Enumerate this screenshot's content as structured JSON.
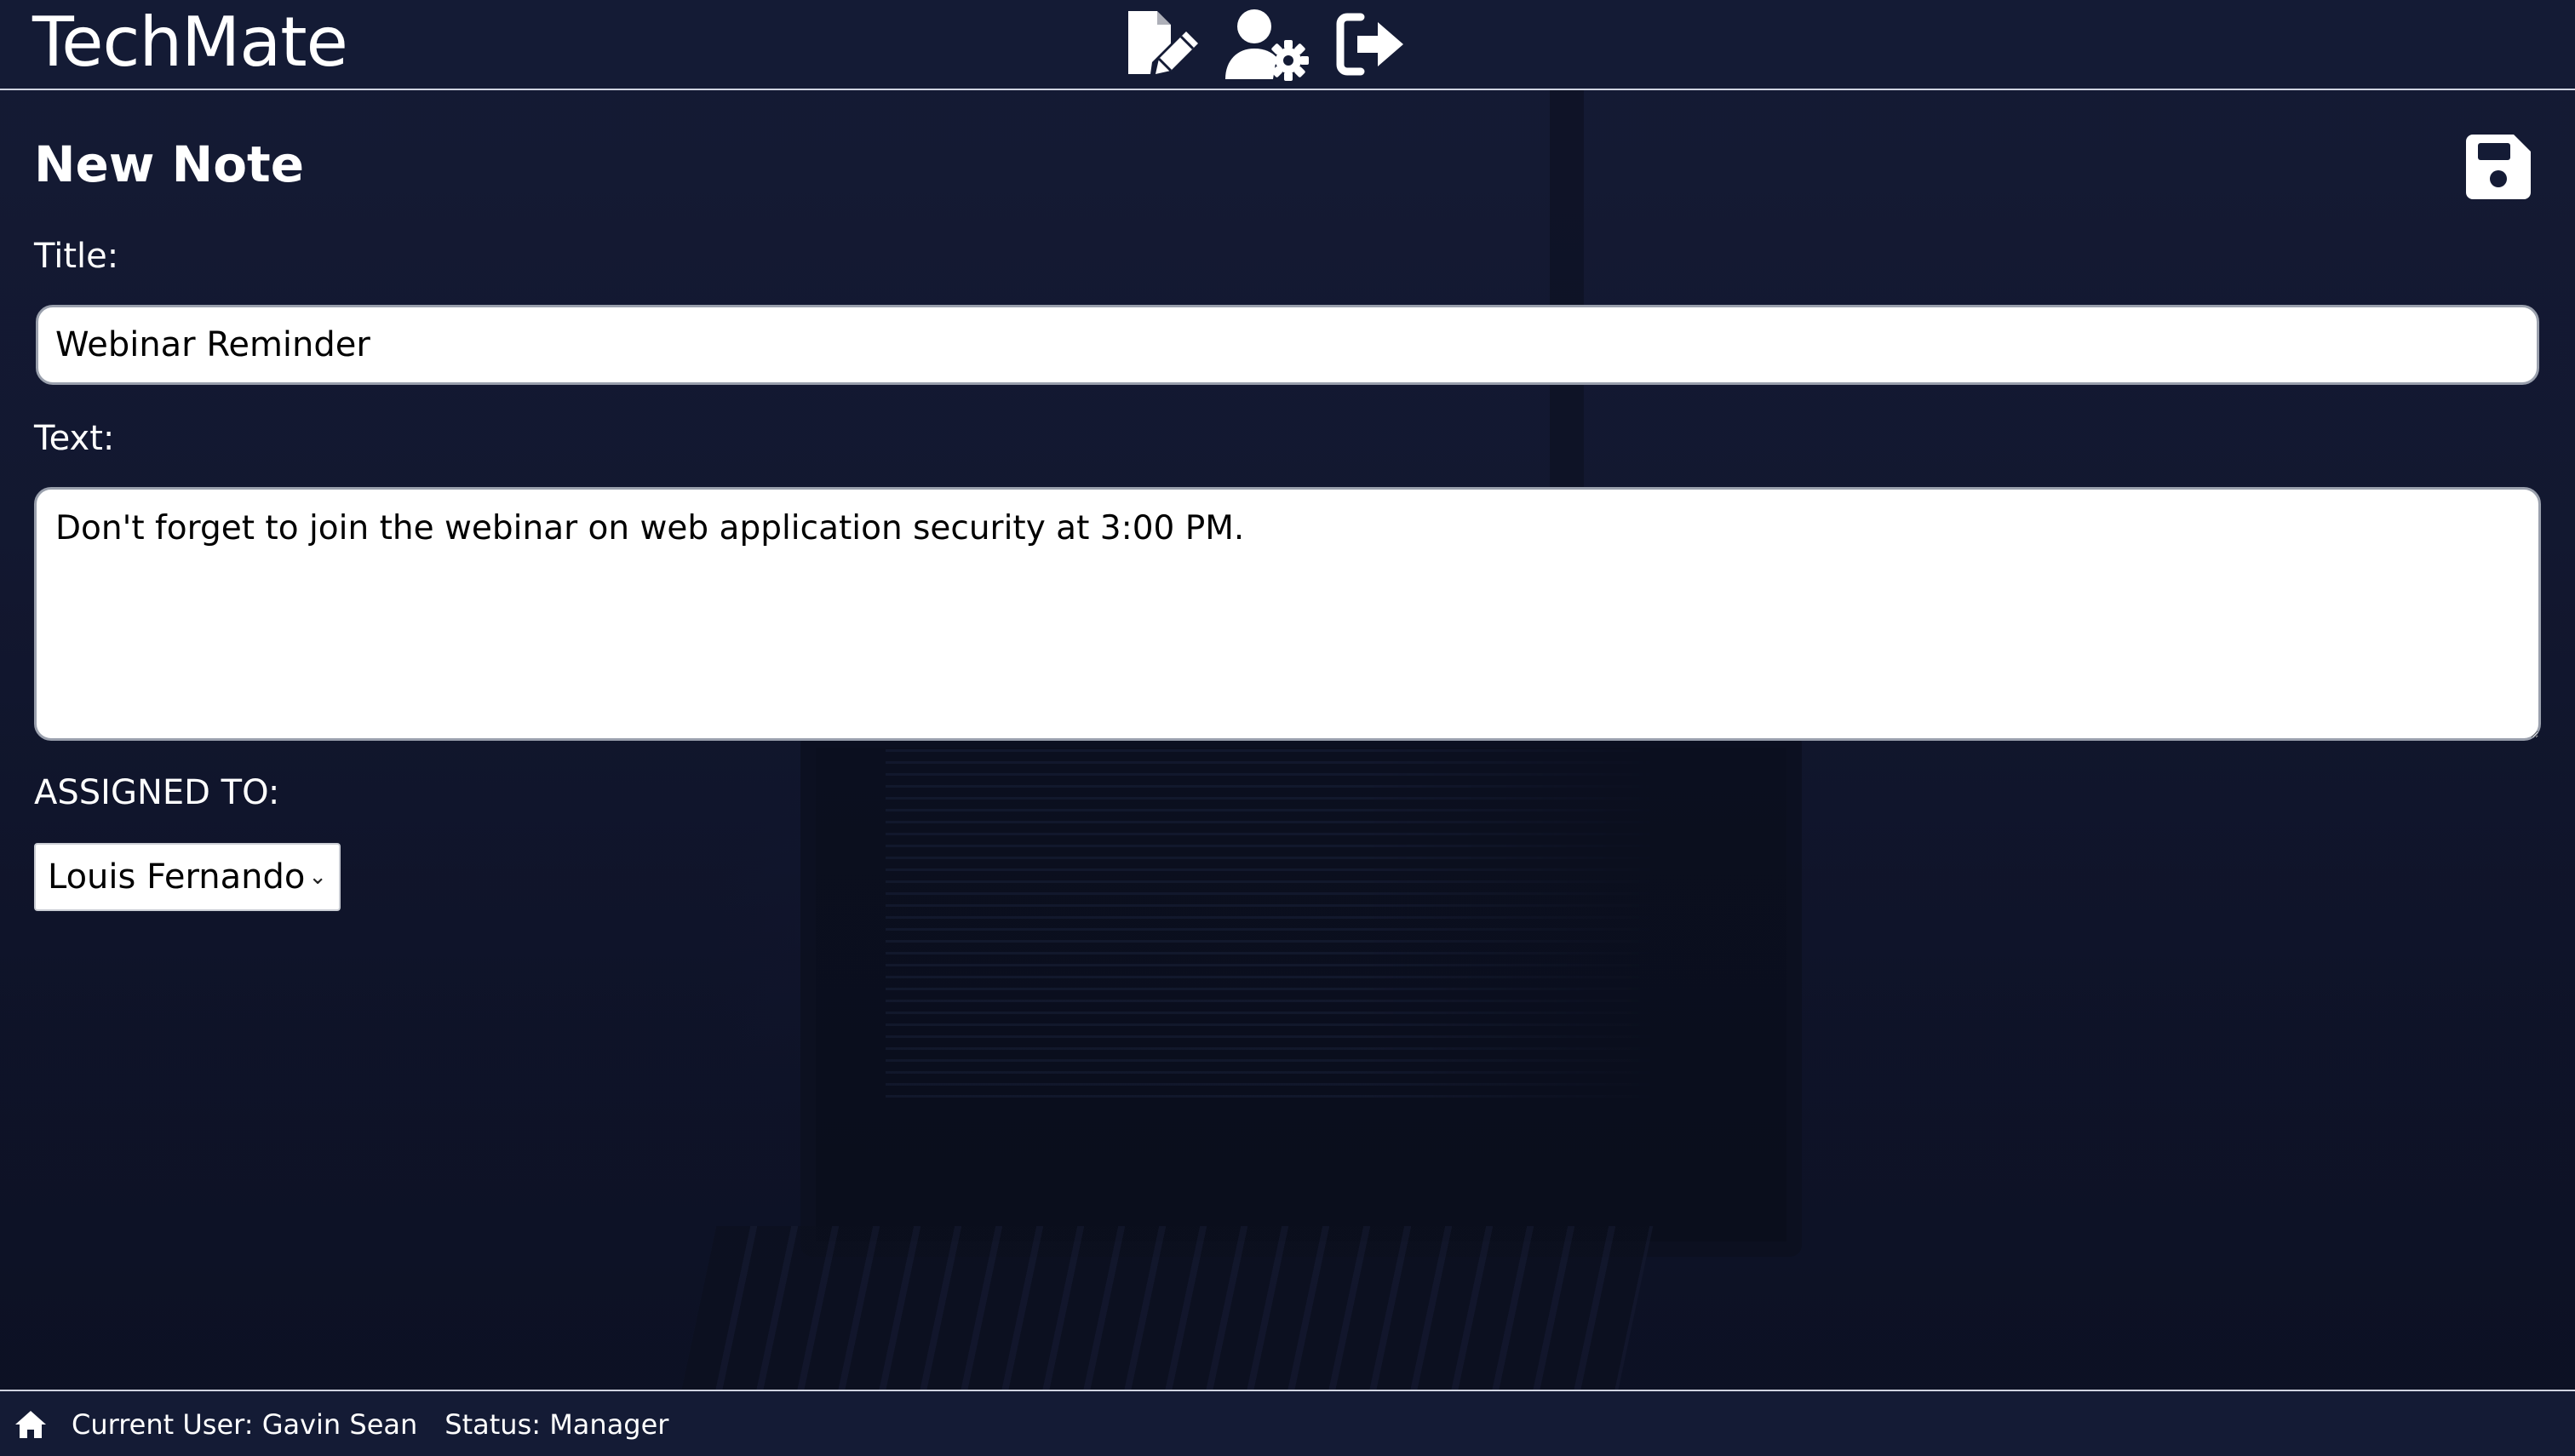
{
  "app": {
    "brand": "TechMate"
  },
  "header": {
    "icons": [
      {
        "name": "new-note-icon"
      },
      {
        "name": "user-settings-icon"
      },
      {
        "name": "logout-icon"
      }
    ]
  },
  "form": {
    "page_title": "New Note",
    "save_icon": "save-icon",
    "title_label": "Title:",
    "title_value": "Webinar Reminder",
    "text_label": "Text:",
    "text_value": "Don't forget to join the webinar on web application security at 3:00 PM.",
    "assigned_label": "ASSIGNED TO:",
    "assigned_value": "Louis Fernando"
  },
  "footer": {
    "home_icon": "home-icon",
    "current_user": "Current User: Gavin Sean",
    "status": "Status: Manager"
  },
  "colors": {
    "bar_background": "#141b35",
    "page_background": "#141a33",
    "text": "#ffffff"
  }
}
